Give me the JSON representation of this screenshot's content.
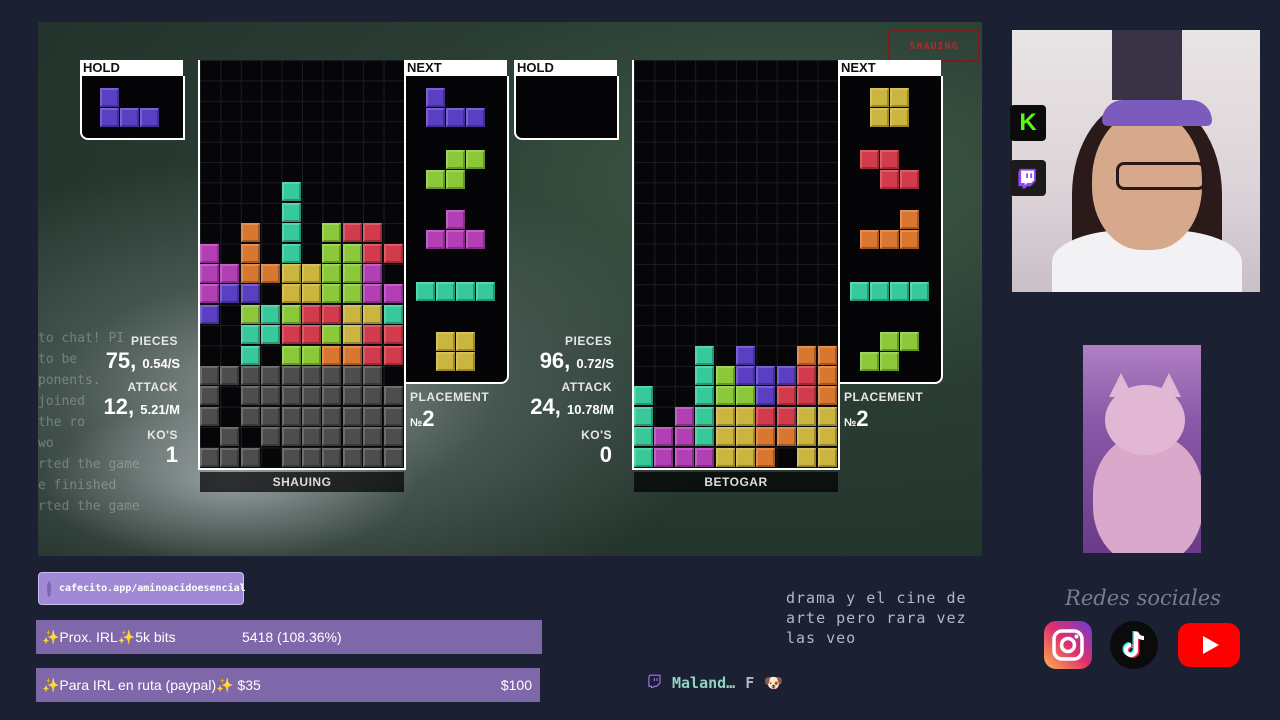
{
  "game": {
    "streamer_tag": "SHAUING",
    "player1": {
      "hold_label": "HOLD",
      "next_label": "NEXT",
      "pieces_label": "PIECES",
      "pieces": "75,",
      "pps": "0.54/S",
      "attack_label": "ATTACK",
      "attack": "12,",
      "apm": "5.21/M",
      "kos_label": "KO'S",
      "kos": "1",
      "placement_label": "PLACEMENT",
      "placement_prefix": "№",
      "placement": "2",
      "name": "SHAUING"
    },
    "player2": {
      "hold_label": "HOLD",
      "next_label": "NEXT",
      "pieces_label": "PIECES",
      "pieces": "96,",
      "pps": "0.72/S",
      "attack_label": "ATTACK",
      "attack": "24,",
      "apm": "10.78/M",
      "kos_label": "KO'S",
      "kos": "0",
      "placement_label": "PLACEMENT",
      "placement_prefix": "№",
      "placement": "2",
      "name": "BETOGAR"
    },
    "ghost_chat": [
      "to chat! PI",
      "to be",
      "ponents.",
      "joined",
      "the ro",
      "wo",
      "rted the game",
      "e finished",
      "rted the game"
    ],
    "colors": {
      "J": "#5b3fc2",
      "S": "#8bc93a",
      "T": "#b23fb3",
      "I": "#37c99a",
      "O": "#cbb53e",
      "Z": "#d13b4b",
      "L": "#d9762f",
      "garbage": "#4d4d4d"
    }
  },
  "sidebar": {
    "kick_icon": "kick-icon",
    "twitch_icon": "twitch-icon"
  },
  "widgets": {
    "cafecito": "cafecito.app/aminoacidoesencial",
    "goal1": {
      "label": "✨Prox. IRL✨5k bits",
      "progress": "5418 (108.36%)",
      "end": ""
    },
    "goal2": {
      "label": "✨Para IRL en ruta (paypal)✨ $35",
      "progress": "",
      "end": "$100"
    }
  },
  "chat": {
    "message": "drama y el cine de arte pero rara vez las veo",
    "username": "Maland…",
    "text": "F",
    "emote": "🐶"
  },
  "socials": {
    "title": "Redes sociales"
  }
}
